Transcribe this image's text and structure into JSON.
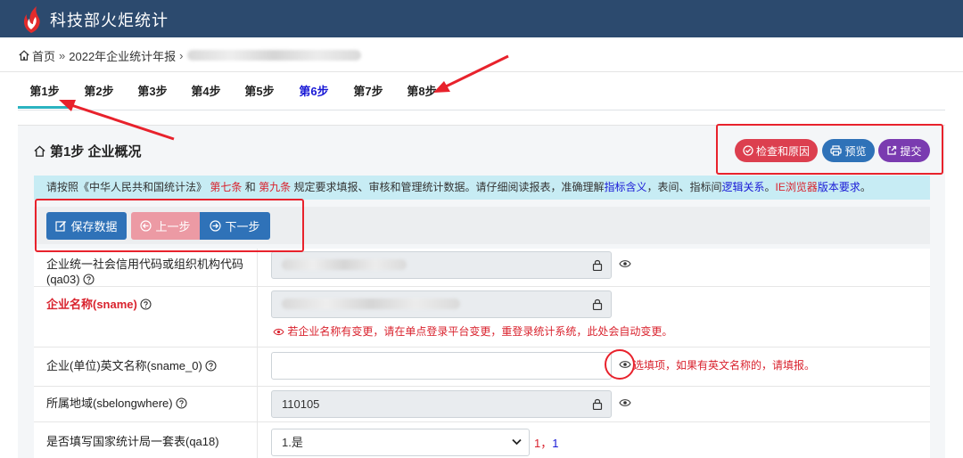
{
  "header": {
    "app_title": "科技部火炬统计"
  },
  "breadcrumb": {
    "home": "首页",
    "sep": "»",
    "report": "2022年企业统计年报",
    "sep2": "›"
  },
  "steps": [
    "第1步",
    "第2步",
    "第3步",
    "第4步",
    "第5步",
    "第6步",
    "第7步",
    "第8步"
  ],
  "panel": {
    "title": "第1步 企业概况",
    "buttons": {
      "check": "检查和原因",
      "preview": "预览",
      "submit": "提交"
    }
  },
  "notice": {
    "p1": "请按照《中华人民共和国统计法》",
    "link1": "第七条",
    "p2": "和",
    "link2": "第九条",
    "p3": "规定要求填报、审核和管理统计数据。请仔细阅读报表，准确理解",
    "link3": "指标含义",
    "p4": "，表间、指标间",
    "link4": "逻辑关系",
    "p5": "。",
    "link5": "IE浏览器",
    "link6": "版本要求",
    "p6": "。"
  },
  "actions": {
    "save": "保存数据",
    "prev": "上一步",
    "next": "下一步"
  },
  "form": {
    "credit_code": {
      "label1": "企业统一社会信用代码或组织机构代码",
      "label2": "(qa03)"
    },
    "company_name": {
      "label": "企业名称(sname)",
      "hint": "若企业名称有变更，请在单点登录平台变更，重登录统计系统，此处会自动变更。"
    },
    "english_name": {
      "label": "企业(单位)英文名称(sname_0)",
      "value": "",
      "hint": "选填项，如果有英文名称的，请填报。"
    },
    "region": {
      "label": "所属地域(sbelongwhere)",
      "value": "110105"
    },
    "qa18": {
      "label": "是否填写国家统计局一套表(qa18)",
      "value": "1.是",
      "code1": "1",
      "comma": "，",
      "code2": "1"
    }
  },
  "colors": {
    "topbar": "#2c4a6e",
    "accent_teal": "#2bb3c0",
    "primary": "#2f72b8",
    "danger": "#dc3f4f",
    "purple": "#7a3bb0",
    "required_red": "#d9232e",
    "notice_bg": "#c7ecf4"
  }
}
